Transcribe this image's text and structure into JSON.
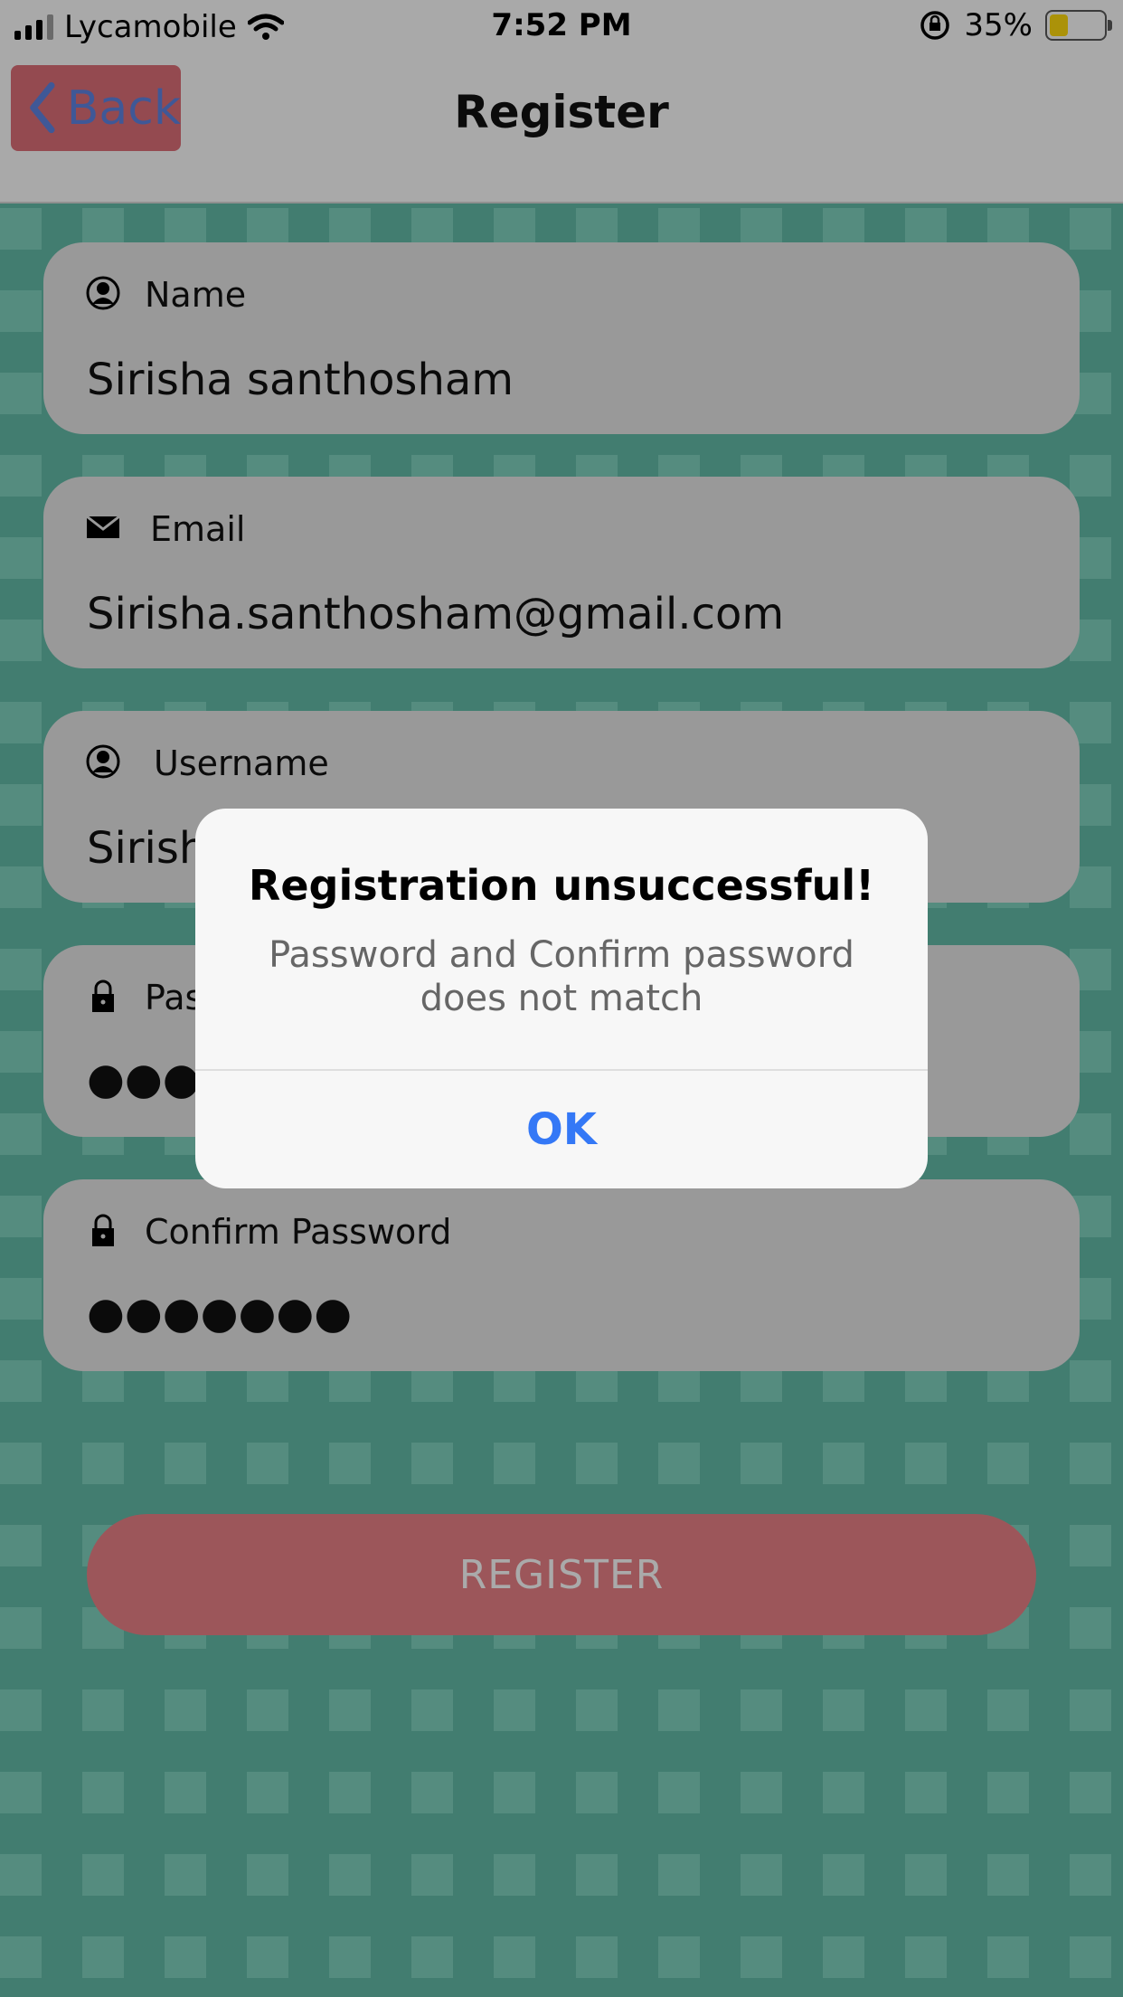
{
  "status_bar": {
    "carrier": "Lycamobile",
    "time": "7:52 PM",
    "battery_percent": "35%",
    "battery_color": "#f5d20d"
  },
  "nav": {
    "back_label": "Back",
    "title": "Register"
  },
  "form": {
    "name": {
      "label": "Name",
      "value": "Sirisha santhosham",
      "icon": "person-icon"
    },
    "email": {
      "label": "Email",
      "value": "Sirisha.santhosham@gmail.com",
      "icon": "envelope-icon"
    },
    "username": {
      "label": "Username",
      "value": "Sirish",
      "icon": "person-icon"
    },
    "password": {
      "label": "Pas",
      "masked_value": "●●●",
      "icon": "lock-icon"
    },
    "confirm_password": {
      "label": "Confirm Password",
      "masked_value": "●●●●●●●",
      "icon": "lock-icon"
    }
  },
  "register_button": {
    "label": "REGISTER",
    "color": "#e07c82"
  },
  "alert": {
    "title": "Registration unsuccessful!",
    "message": "Password and Confirm password does not match",
    "ok_label": "OK"
  },
  "colors": {
    "background": "#5fb3a1",
    "accent": "#3478f6",
    "back_button": "#d46b73"
  }
}
